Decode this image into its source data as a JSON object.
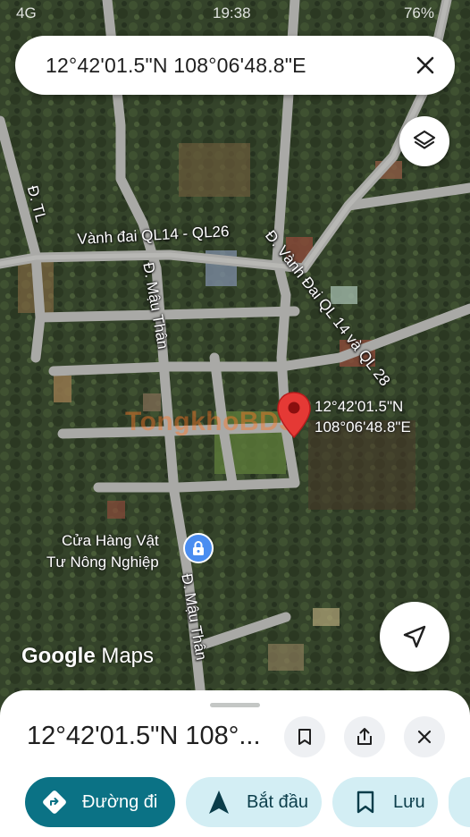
{
  "status_bar": {
    "network": "4G",
    "time": "19:38",
    "battery": "76%"
  },
  "search": {
    "value": "12°42'01.5\"N 108°06'48.8\"E"
  },
  "map": {
    "roads": {
      "dtl": "Đ. TL",
      "vanh_dai_ql14_ql26": "Vành đai QL14 - QL26",
      "mau_than_north": "Đ. Mậu Thân",
      "vanh_dai_ql14_ql28": "Đ. Vành Đai QL 14 và QL 28",
      "mau_than_south": "Đ. Mậu Thân"
    },
    "pin": {
      "line1": "12°42'01.5\"N",
      "line2": "108°06'48.8\"E"
    },
    "poi": {
      "line1": "Cửa Hàng Vật",
      "line2": "Tư Nông Nghiệp"
    },
    "watermark": "TongkhoBDS",
    "logo": {
      "google": "Google",
      "maps": "Maps"
    }
  },
  "sheet": {
    "title": "12°42'01.5\"N 108°...",
    "actions": {
      "directions": "Đường đi",
      "start": "Bắt đầu",
      "save": "Lưu"
    }
  },
  "colors": {
    "primary_action": "#0b7285",
    "secondary_action": "#d3eef4",
    "pin": "#e53935"
  },
  "icons": [
    "close-icon",
    "layers-icon",
    "pin-icon",
    "lock-icon",
    "navigation-arrow-icon",
    "bookmark-icon",
    "share-icon",
    "directions-icon",
    "start-arrow-icon"
  ]
}
